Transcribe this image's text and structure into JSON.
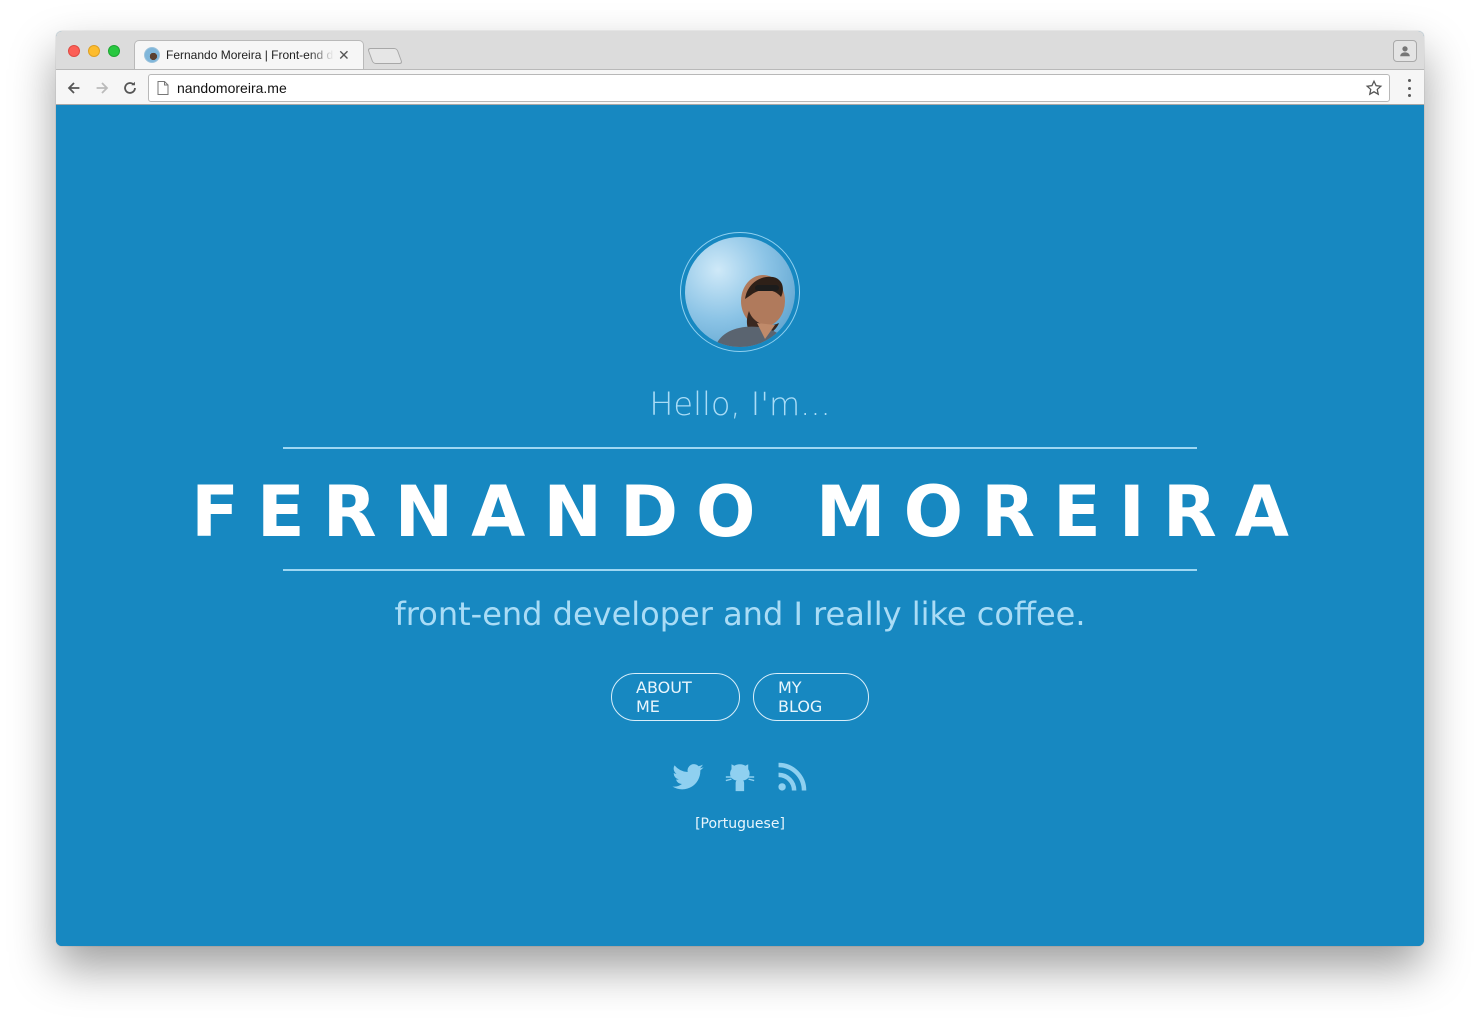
{
  "browser": {
    "tab_title": "Fernando Moreira | Front-end developer",
    "url": "nandomoreira.me",
    "icons": {
      "back": "arrow-left-icon",
      "forward": "arrow-right-icon",
      "reload": "reload-icon",
      "page": "page-icon",
      "bookmark": "star-icon",
      "menu": "more-vert-icon",
      "profile": "person-icon",
      "close": "close-icon"
    }
  },
  "hero": {
    "greeting": "Hello, I'm...",
    "name": "FERNANDO MOREIRA",
    "tagline": "front-end developer and I really like coffee.",
    "buttons": {
      "about": "ABOUT ME",
      "blog": "MY BLOG"
    },
    "social": [
      "twitter-icon",
      "github-icon",
      "rss-icon"
    ],
    "language_link": "[Portuguese]"
  },
  "colors": {
    "background": "#1788c1",
    "accent_text": "#a9dcf6",
    "white": "#ffffff"
  }
}
